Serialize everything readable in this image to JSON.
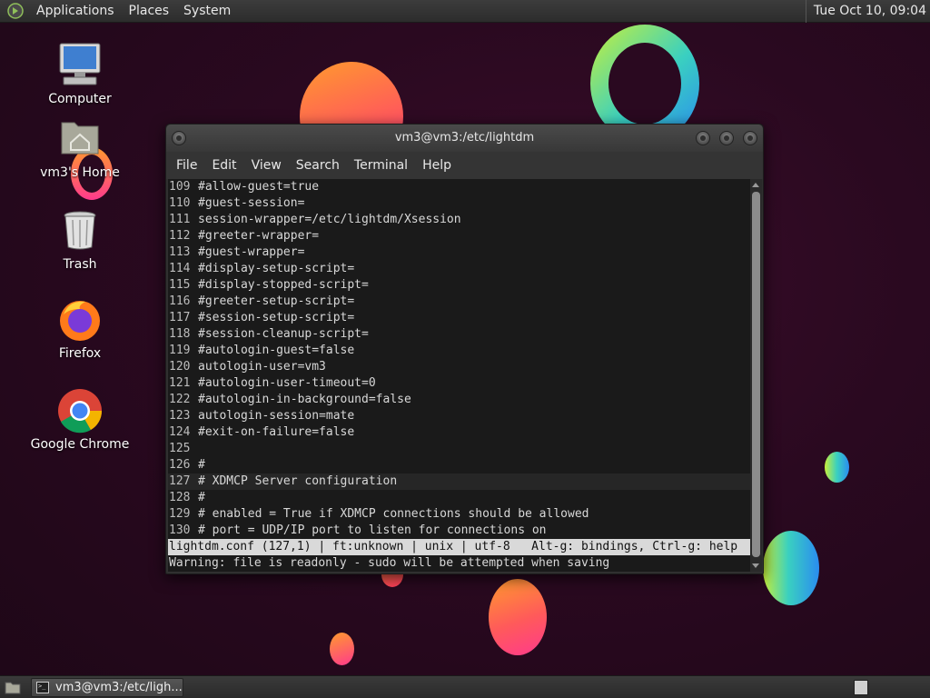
{
  "top_panel": {
    "menus": [
      "Applications",
      "Places",
      "System"
    ],
    "clock": "Tue Oct 10, 09:04"
  },
  "desktop_icons": [
    {
      "label": "Computer",
      "icon": "computer-icon"
    },
    {
      "label": "vm3's Home",
      "icon": "home-folder-icon"
    },
    {
      "label": "Trash",
      "icon": "trash-icon"
    },
    {
      "label": "Firefox",
      "icon": "firefox-icon"
    },
    {
      "label": "Google Chrome",
      "icon": "chrome-icon"
    }
  ],
  "window": {
    "title": "vm3@vm3:/etc/lightdm",
    "menu": [
      "File",
      "Edit",
      "View",
      "Search",
      "Terminal",
      "Help"
    ]
  },
  "editor": {
    "lines": [
      {
        "num": "109",
        "text": "#allow-guest=true"
      },
      {
        "num": "110",
        "text": "#guest-session="
      },
      {
        "num": "111",
        "text": "session-wrapper=/etc/lightdm/Xsession"
      },
      {
        "num": "112",
        "text": "#greeter-wrapper="
      },
      {
        "num": "113",
        "text": "#guest-wrapper="
      },
      {
        "num": "114",
        "text": "#display-setup-script="
      },
      {
        "num": "115",
        "text": "#display-stopped-script="
      },
      {
        "num": "116",
        "text": "#greeter-setup-script="
      },
      {
        "num": "117",
        "text": "#session-setup-script="
      },
      {
        "num": "118",
        "text": "#session-cleanup-script="
      },
      {
        "num": "119",
        "text": "#autologin-guest=false"
      },
      {
        "num": "120",
        "text": "autologin-user=vm3"
      },
      {
        "num": "121",
        "text": "#autologin-user-timeout=0"
      },
      {
        "num": "122",
        "text": "#autologin-in-background=false"
      },
      {
        "num": "123",
        "text": "autologin-session=mate"
      },
      {
        "num": "124",
        "text": "#exit-on-failure=false"
      },
      {
        "num": "125",
        "text": ""
      },
      {
        "num": "126",
        "text": "#"
      },
      {
        "num": "127",
        "text": "# XDMCP Server configuration"
      },
      {
        "num": "128",
        "text": "#"
      },
      {
        "num": "129",
        "text": "# enabled = True if XDMCP connections should be allowed"
      },
      {
        "num": "130",
        "text": "# port = UDP/IP port to listen for connections on"
      }
    ],
    "cursor_line": "127",
    "status_line": "lightdm.conf (127,1) | ft:unknown | unix | utf-8   Alt-g: bindings, Ctrl-g: help",
    "message": "Warning: file is readonly - sudo will be attempted when saving"
  },
  "taskbar": {
    "tasks": [
      {
        "label": "vm3@vm3:/etc/ligh..."
      }
    ]
  },
  "colors": {
    "panel": "#2c2c2c",
    "terminal_bg": "#1a1a1a",
    "status_bg": "#d9d9d9",
    "wallpaper": "#2a0920"
  }
}
